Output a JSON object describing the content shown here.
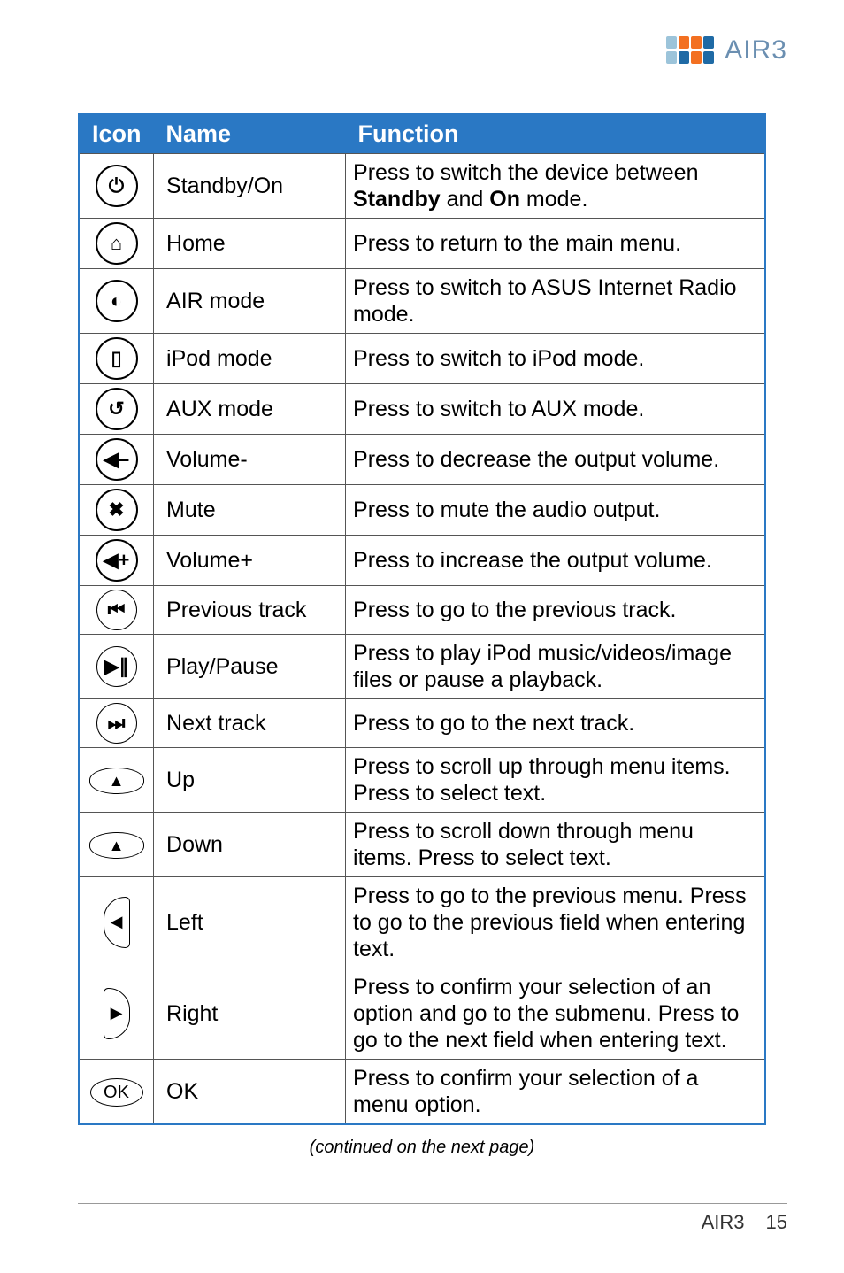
{
  "brand": {
    "name": "AIR3"
  },
  "table": {
    "headers": {
      "icon": "Icon",
      "name": "Name",
      "function": "Function"
    },
    "rows": [
      {
        "icon": "power-icon",
        "glyph": "⏻",
        "name": "Standby/On",
        "function_html": "Press to switch the device between <b>Standby</b> and <b>On</b> mode."
      },
      {
        "icon": "home-icon",
        "glyph": "⌂",
        "name": "Home",
        "function_html": "Press to return to the main menu."
      },
      {
        "icon": "air-mode-icon",
        "glyph": "◐",
        "name": "AIR mode",
        "function_html": "Press to switch to ASUS Internet Radio mode."
      },
      {
        "icon": "ipod-icon",
        "glyph": "▯",
        "name": "iPod mode",
        "function_html": "Press to switch to iPod mode."
      },
      {
        "icon": "aux-icon",
        "glyph": "↺",
        "name": "AUX mode",
        "function_html": "Press to switch to AUX mode."
      },
      {
        "icon": "vol-down-icon",
        "glyph": "◀–",
        "name": "Volume-",
        "function_html": "Press to decrease the output volume."
      },
      {
        "icon": "mute-icon",
        "glyph": "✖",
        "name": "Mute",
        "function_html": "Press to mute the audio output."
      },
      {
        "icon": "vol-up-icon",
        "glyph": "◀+",
        "name": "Volume+",
        "function_html": "Press to increase the output volume."
      },
      {
        "icon": "prev-track-icon",
        "glyph": "⏮",
        "name": "Previous track",
        "function_html": "Press to go to the previous track."
      },
      {
        "icon": "play-pause-icon",
        "glyph": "▶∥",
        "name": "Play/Pause",
        "function_html": "Press to play iPod music/videos/image files or pause a playback."
      },
      {
        "icon": "next-track-icon",
        "glyph": "⏭",
        "name": "Next track",
        "function_html": "Press to go to the next track."
      },
      {
        "icon": "up-icon",
        "glyph": "▲",
        "shape": "eye",
        "name": "Up",
        "function_html": "Press to scroll up through menu items. Press to select text."
      },
      {
        "icon": "down-icon",
        "glyph": "▲",
        "shape": "eye",
        "name": "Down",
        "function_html": "Press to scroll down through menu items. Press to select text."
      },
      {
        "icon": "left-icon",
        "glyph": "◀",
        "shape": "side-l",
        "name": "Left",
        "function_html": "Press to go to the previous menu. Press to go to the previous field when entering text."
      },
      {
        "icon": "right-icon",
        "glyph": "▶",
        "shape": "side-r",
        "name": "Right",
        "function_html": "Press to confirm your selection of an option and go to the submenu. Press to go to the next field when entering text."
      },
      {
        "icon": "ok-icon",
        "glyph": "OK",
        "shape": "oval",
        "name": "OK",
        "function_html": "Press to confirm your selection of a menu option."
      }
    ]
  },
  "continuation": "(continued on the next page)",
  "footer": {
    "model": "AIR3",
    "page": "15"
  }
}
